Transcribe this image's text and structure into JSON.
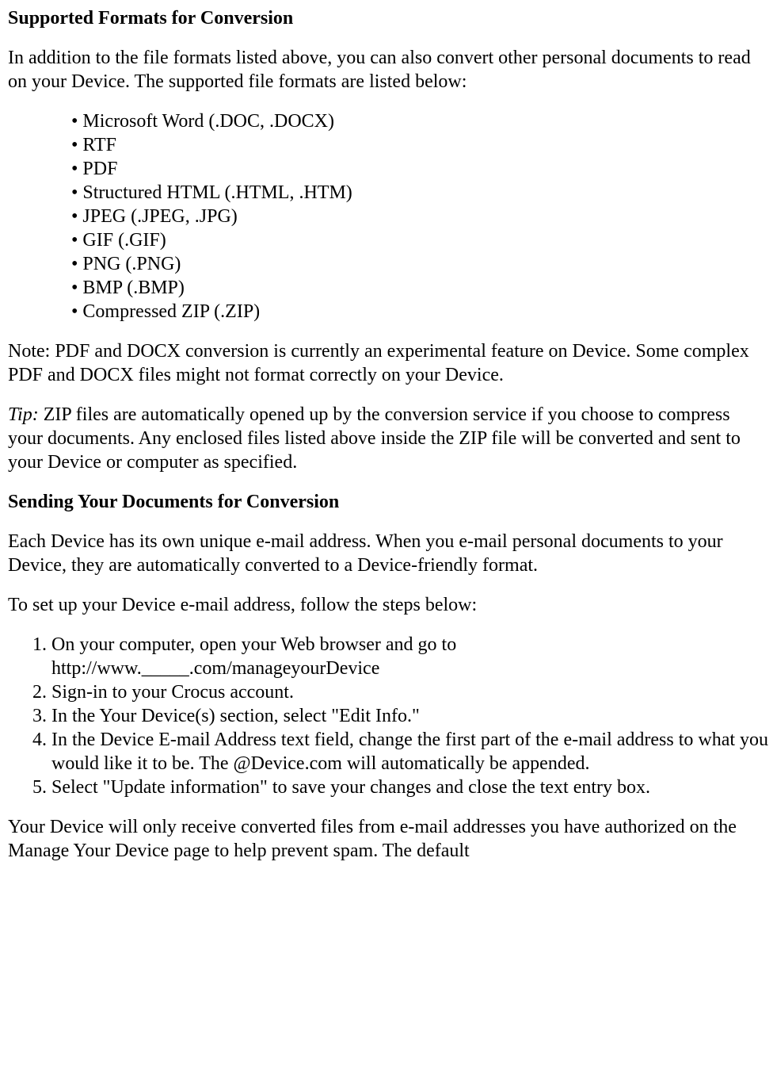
{
  "section1": {
    "heading": "Supported Formats for Conversion",
    "intro": "In addition to the file formats listed above, you can also convert other personal documents to read on your Device. The supported file formats are listed below:",
    "formats": [
      "Microsoft Word (.DOC, .DOCX)",
      "RTF",
      "PDF",
      "Structured HTML (.HTML, .HTM)",
      "JPEG (.JPEG, .JPG)",
      "GIF (.GIF)",
      "PNG (.PNG)",
      "BMP (.BMP)",
      "Compressed ZIP (.ZIP)"
    ],
    "note": "Note: PDF and DOCX conversion is currently an experimental feature on Device. Some complex PDF and DOCX files might not format correctly on your Device.",
    "tip_label": "Tip:",
    "tip_text": " ZIP files are automatically opened up by the conversion service if you choose to compress your documents. Any enclosed files listed above inside the ZIP file will be converted and sent to your Device or computer as specified."
  },
  "section2": {
    "heading": "Sending Your Documents for Conversion",
    "intro": "Each Device has its own unique e-mail address. When you e-mail personal documents to your Device, they are automatically converted to a Device-friendly format.",
    "steps_intro": "To set up your Device e-mail address, follow the steps below:",
    "steps": [
      "On your computer, open your Web browser and go to http://www._____.com/manageyourDevice",
      "Sign-in to your Crocus account.",
      "In the Your Device(s) section, select \"Edit Info.\"",
      "In the Device E-mail Address text field, change the first part of the e-mail address to what you would like it to be. The @Device.com will automatically be appended.",
      "Select \"Update information\" to save your changes and close the text entry box."
    ],
    "trailing": "Your Device will only receive converted files from e-mail addresses you have authorized on the Manage Your Device page to help prevent spam. The default"
  }
}
